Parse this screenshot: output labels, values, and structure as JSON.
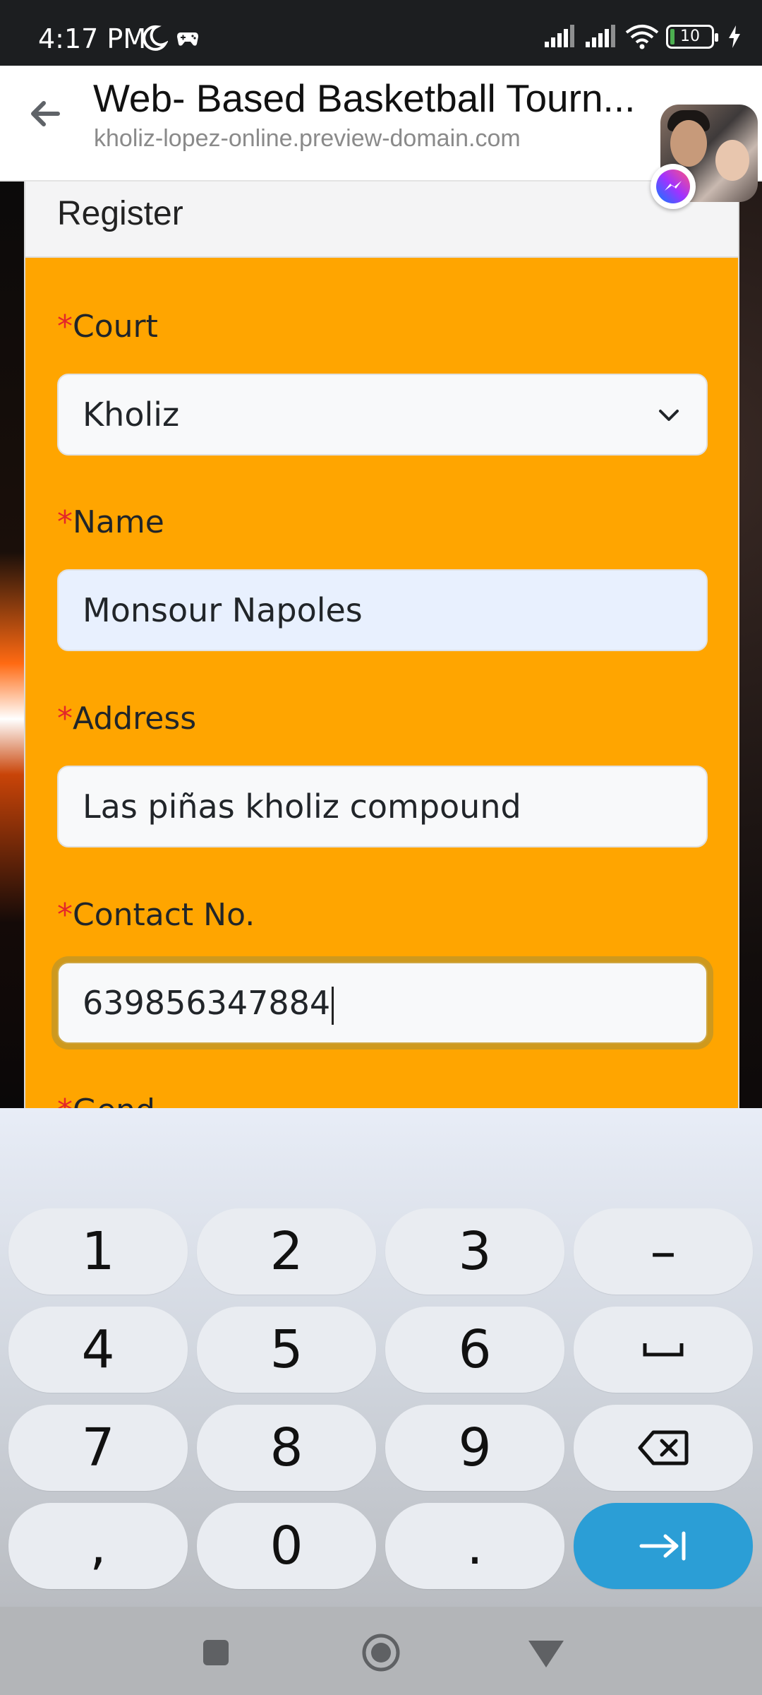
{
  "status_bar": {
    "time": "4:17 PM",
    "battery": "10",
    "icons": [
      "moon-icon",
      "game-icon",
      "signal-icon",
      "signal-icon",
      "wifi-icon",
      "battery-icon",
      "charging-icon"
    ]
  },
  "browser": {
    "title": "Web- Based Basketball Tourn...",
    "url": "kholiz-lopez-online.preview-domain.com"
  },
  "form": {
    "header": "Register",
    "required_mark": "*",
    "fields": [
      {
        "label": "Court",
        "value": "Kholiz",
        "type": "select"
      },
      {
        "label": "Name",
        "value": "Monsour Napoles",
        "type": "text"
      },
      {
        "label": "Address",
        "value": "Las piñas kholiz compound",
        "type": "text"
      },
      {
        "label": "Contact No.",
        "value": "639856347884",
        "type": "text"
      }
    ],
    "next_label_partial": "*Gend"
  },
  "keyboard": {
    "rows": [
      [
        "1",
        "2",
        "3",
        "–"
      ],
      [
        "4",
        "5",
        "6",
        "␣"
      ],
      [
        "7",
        "8",
        "9",
        "backspace-icon"
      ],
      [
        ",",
        "0",
        ".",
        "next-icon"
      ]
    ],
    "accent": "#2b9ed6"
  },
  "colors": {
    "card_bg": "#ffa500",
    "required": "#e3262a"
  }
}
